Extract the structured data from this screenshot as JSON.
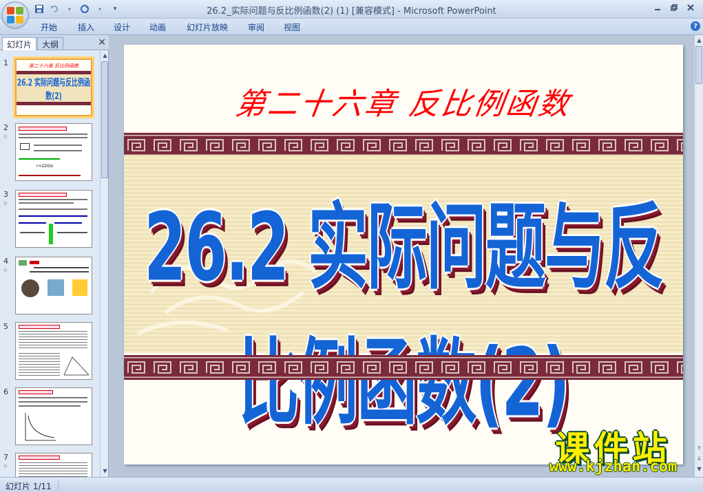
{
  "window": {
    "title": "26.2_实际问题与反比例函数(2) (1) [兼容模式] - Microsoft PowerPoint"
  },
  "ribbon": {
    "tabs": [
      "开始",
      "插入",
      "设计",
      "动画",
      "幻灯片放映",
      "审阅",
      "视图"
    ]
  },
  "left_pane": {
    "tabs": [
      "幻灯片",
      "大纲"
    ],
    "active_tab": "幻灯片",
    "thumbnails": [
      {
        "number": "1",
        "selected": true
      },
      {
        "number": "2",
        "selected": false
      },
      {
        "number": "3",
        "selected": false
      },
      {
        "number": "4",
        "selected": false
      },
      {
        "number": "5",
        "selected": false
      },
      {
        "number": "6",
        "selected": false
      },
      {
        "number": "7",
        "selected": false
      }
    ]
  },
  "slide": {
    "heading": "第二十六章  反比例函数",
    "title": "26.2 实际问题与反比例函数(2)",
    "thumb1_heading": "第二十六章 反比例函数",
    "thumb1_title": "26.2 实际问题与反比例函数(2)"
  },
  "watermark": {
    "text": "课件站",
    "url": "www.kjzhan.com"
  },
  "status": {
    "slide_counter": "幻灯片 1/11"
  },
  "colors": {
    "heading": "#ff0000",
    "title": "#1464d6",
    "band": "#7a2a3c",
    "watermark": "#ffef00"
  },
  "icons": [
    "office-button-icon",
    "save-icon",
    "undo-icon",
    "redo-icon",
    "customize-icon",
    "minimize-icon",
    "restore-icon",
    "close-icon",
    "help-icon",
    "pane-close-icon"
  ]
}
